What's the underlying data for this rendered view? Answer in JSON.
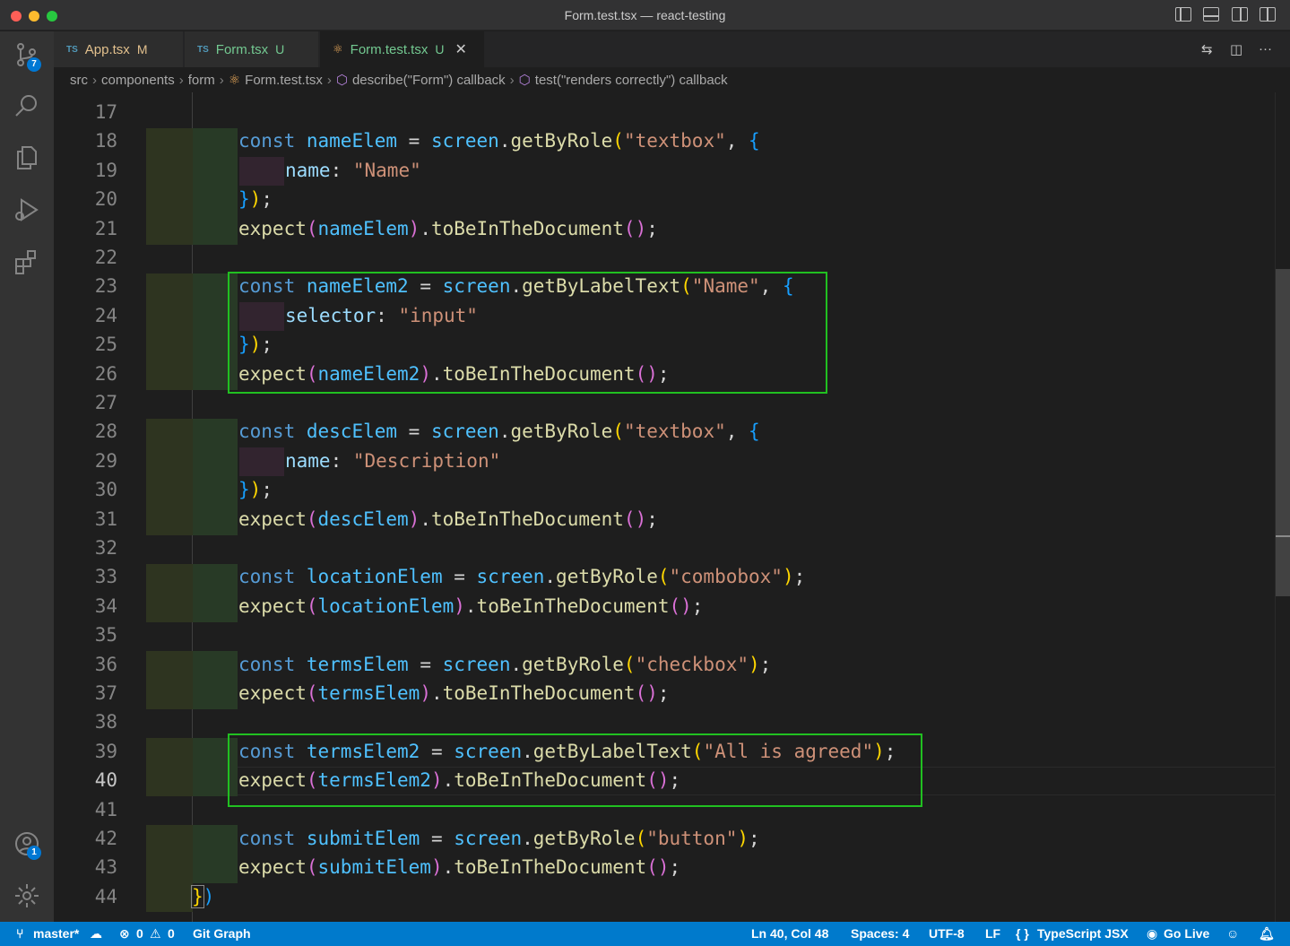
{
  "window": {
    "title": "Form.test.tsx — react-testing"
  },
  "activity": {
    "scm_badge": "7",
    "accounts_badge": "1"
  },
  "tabs": [
    {
      "lang": "TS",
      "name": "App.tsx",
      "status": "M"
    },
    {
      "lang": "TS",
      "name": "Form.tsx",
      "status": "U"
    },
    {
      "name": "Form.test.tsx",
      "status": "U",
      "close": "✕"
    }
  ],
  "breadcrumbs": [
    "src",
    "components",
    "form",
    "Form.test.tsx",
    "describe(\"Form\") callback",
    "test(\"renders correctly\") callback"
  ],
  "editor": {
    "current_line": 40,
    "line_numbers": [
      "17",
      "18",
      "19",
      "20",
      "21",
      "22",
      "23",
      "24",
      "25",
      "26",
      "27",
      "28",
      "29",
      "30",
      "31",
      "32",
      "33",
      "34",
      "35",
      "36",
      "37",
      "38",
      "39",
      "40",
      "41",
      "42",
      "43",
      "44"
    ],
    "code": {
      "l18": {
        "a": "const",
        "b": "nameElem",
        "c": " = ",
        "d": "screen",
        "e": ".",
        "f": "getByRole",
        "g": "(",
        "h": "\"textbox\"",
        "i": ", ",
        "j": "{"
      },
      "l19": {
        "a": "name",
        "b": ": ",
        "c": "\"Name\""
      },
      "l20": {
        "a": "}",
        "b": ")",
        "c": ";"
      },
      "l21": {
        "a": "expect",
        "b": "(",
        "c": "nameElem",
        "d": ")",
        "e": ".",
        "f": "toBeInTheDocument",
        "g": "()",
        "h": ";"
      },
      "l23": {
        "a": "const",
        "b": "nameElem2",
        "c": " = ",
        "d": "screen",
        "e": ".",
        "f": "getByLabelText",
        "g": "(",
        "h": "\"Name\"",
        "i": ", ",
        "j": "{"
      },
      "l24": {
        "a": "selector",
        "b": ": ",
        "c": "\"input\""
      },
      "l25": {
        "a": "}",
        "b": ")",
        "c": ";"
      },
      "l26": {
        "a": "expect",
        "b": "(",
        "c": "nameElem2",
        "d": ")",
        "e": ".",
        "f": "toBeInTheDocument",
        "g": "()",
        "h": ";"
      },
      "l28": {
        "a": "const",
        "b": "descElem",
        "c": " = ",
        "d": "screen",
        "e": ".",
        "f": "getByRole",
        "g": "(",
        "h": "\"textbox\"",
        "i": ", ",
        "j": "{"
      },
      "l29": {
        "a": "name",
        "b": ": ",
        "c": "\"Description\""
      },
      "l30": {
        "a": "}",
        "b": ")",
        "c": ";"
      },
      "l31": {
        "a": "expect",
        "b": "(",
        "c": "descElem",
        "d": ")",
        "e": ".",
        "f": "toBeInTheDocument",
        "g": "()",
        "h": ";"
      },
      "l33": {
        "a": "const",
        "b": "locationElem",
        "c": " = ",
        "d": "screen",
        "e": ".",
        "f": "getByRole",
        "g": "(",
        "h": "\"combobox\"",
        "i": ")",
        "j": ";"
      },
      "l34": {
        "a": "expect",
        "b": "(",
        "c": "locationElem",
        "d": ")",
        "e": ".",
        "f": "toBeInTheDocument",
        "g": "()",
        "h": ";"
      },
      "l36": {
        "a": "const",
        "b": "termsElem",
        "c": " = ",
        "d": "screen",
        "e": ".",
        "f": "getByRole",
        "g": "(",
        "h": "\"checkbox\"",
        "i": ")",
        "j": ";"
      },
      "l37": {
        "a": "expect",
        "b": "(",
        "c": "termsElem",
        "d": ")",
        "e": ".",
        "f": "toBeInTheDocument",
        "g": "()",
        "h": ";"
      },
      "l39": {
        "a": "const",
        "b": "termsElem2",
        "c": " = ",
        "d": "screen",
        "e": ".",
        "f": "getByLabelText",
        "g": "(",
        "h": "\"All is agreed\"",
        "i": ")",
        "j": ";"
      },
      "l40": {
        "a": "expect",
        "b": "(",
        "c": "termsElem2",
        "d": ")",
        "e": ".",
        "f": "toBeInTheDocument",
        "g": "()",
        "h": ";"
      },
      "l42": {
        "a": "const",
        "b": "submitElem",
        "c": " = ",
        "d": "screen",
        "e": ".",
        "f": "getByRole",
        "g": "(",
        "h": "\"button\"",
        "i": ")",
        "j": ";"
      },
      "l43": {
        "a": "expect",
        "b": "(",
        "c": "submitElem",
        "d": ")",
        "e": ".",
        "f": "toBeInTheDocument",
        "g": "()",
        "h": ";"
      },
      "l44": {
        "a": "}",
        "b": ")"
      }
    }
  },
  "statusbar": {
    "branch": "master*",
    "errors": "0",
    "warnings": "0",
    "git_graph": "Git Graph",
    "position": "Ln 40, Col 48",
    "spaces": "Spaces: 4",
    "encoding": "UTF-8",
    "eol": "LF",
    "language": "TypeScript JSX",
    "go_live": "Go Live"
  }
}
